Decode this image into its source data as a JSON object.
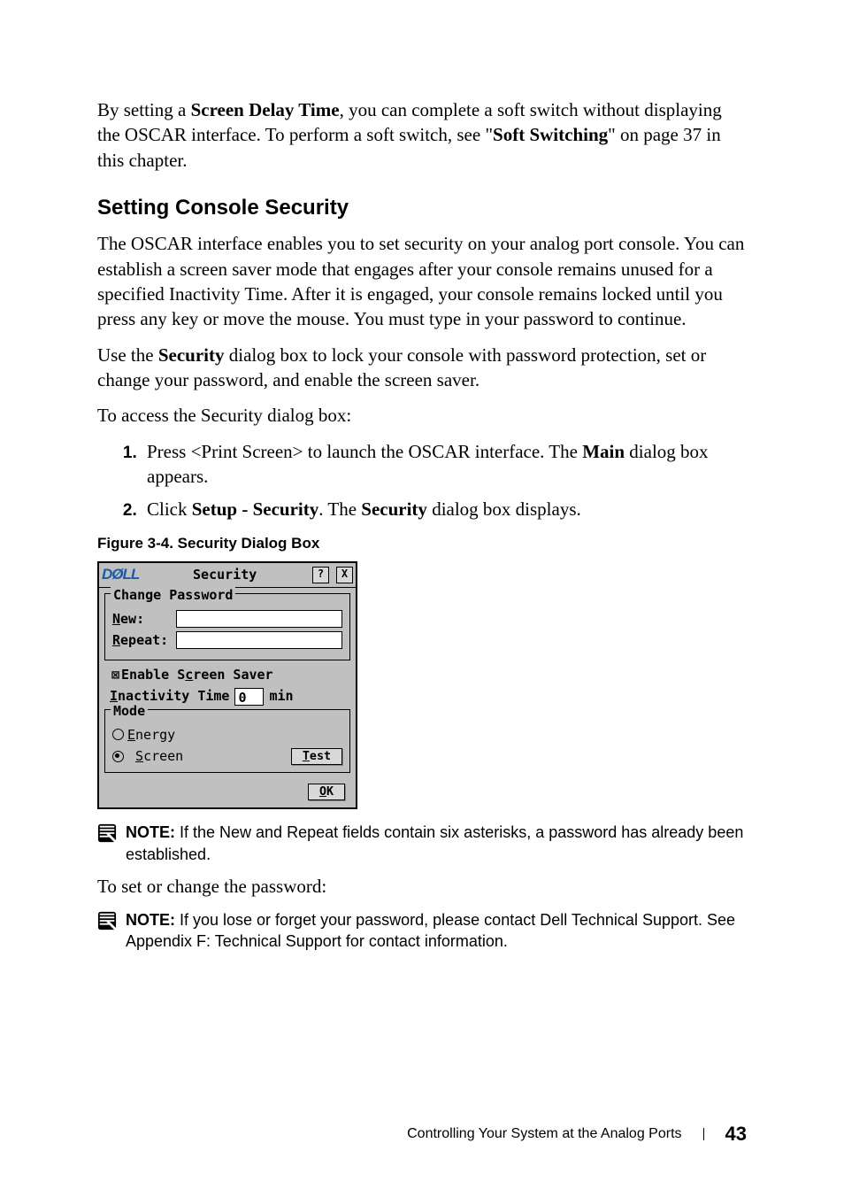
{
  "intro": {
    "para1_a": "By setting a ",
    "para1_b": "Screen Delay Time",
    "para1_c": ", you can complete a soft switch without displaying the OSCAR interface. To perform a soft switch, see \"",
    "para1_d": "Soft Switching",
    "para1_e": "\" on page 37 in this chapter."
  },
  "section_title": "Setting Console Security",
  "para2": "The OSCAR interface enables you to set security on your analog port console. You can establish a screen saver mode that engages after your console remains unused for a specified Inactivity Time. After it is engaged, your console remains locked until you press any key or move the mouse. You must type in your password to continue.",
  "para3_a": "Use the ",
  "para3_b": "Security",
  "para3_c": " dialog box to lock your console with password protection, set or change your password, and enable the screen saver.",
  "para4": "To access the Security dialog box:",
  "steps": {
    "s1_a": "Press <Print Screen> to launch the OSCAR interface. The ",
    "s1_b": "Main",
    "s1_c": " dialog box appears.",
    "s2_a": "Click ",
    "s2_b": "Setup - Security",
    "s2_c": ". The ",
    "s2_d": "Security",
    "s2_e": " dialog box displays."
  },
  "figure_caption": "Figure 3-4.    Security Dialog Box",
  "dialog": {
    "brand": "DØLL",
    "title": "Security",
    "help": "?",
    "close": "X",
    "group1_legend": "Change Password",
    "new_prefix": "N",
    "new_rest": "ew:",
    "repeat_prefix": "R",
    "repeat_rest": "epeat:",
    "enable_cb": "⊠",
    "enable_a": "Enable S",
    "enable_u": "c",
    "enable_b": "reen Saver",
    "inact_prefix": "I",
    "inact_rest": "nactivity Time",
    "inact_value": "0",
    "inact_unit": "min",
    "group2_legend": "Mode",
    "energy_prefix": "E",
    "energy_rest": "nergy",
    "screen_prefix": "S",
    "screen_rest": "creen",
    "test_prefix": "T",
    "test_rest": "est",
    "ok_prefix": "O",
    "ok_rest": "K"
  },
  "notes": {
    "label": "NOTE:",
    "n1": " If the New and Repeat fields contain six asterisks, a password has already been established.",
    "n2": " If you lose or forget your password, please contact Dell Technical Support. See Appendix F: Technical Support for contact information."
  },
  "para5": "To set or change the password:",
  "footer": {
    "text": "Controlling Your System at the Analog Ports",
    "page": "43"
  }
}
